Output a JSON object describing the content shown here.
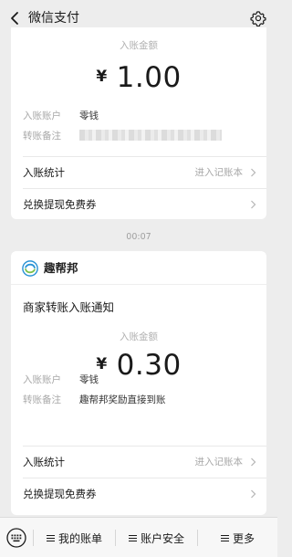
{
  "header": {
    "title": "微信支付"
  },
  "time_divider": "00:07",
  "messages": [
    {
      "amount_label": "入账金额",
      "currency_symbol": "¥",
      "amount": "1.00",
      "account_key": "入账账户",
      "account_value": "零钱",
      "remark_key": "转账备注",
      "rows": [
        {
          "label": "入账统计",
          "hint": "进入记账本"
        },
        {
          "label": "兑换提现免费券",
          "hint": ""
        }
      ]
    },
    {
      "brand_name": "趣帮邦",
      "notice_title": "商家转账入账通知",
      "amount_label": "入账金额",
      "currency_symbol": "¥",
      "amount": "0.30",
      "account_key": "入账账户",
      "account_value": "零钱",
      "remark_key": "转账备注",
      "remark_value": "趣帮邦奖励直接到账",
      "rows": [
        {
          "label": "入账统计",
          "hint": "进入记账本"
        },
        {
          "label": "兑换提现免费券",
          "hint": ""
        }
      ]
    }
  ],
  "bottom_menu": {
    "tabs": [
      "我的账单",
      "账户安全",
      "更多"
    ]
  },
  "icons": {
    "back": "back-icon",
    "settings": "gear-icon",
    "keyboard": "keyboard-icon",
    "chevron": "chevron-right-icon"
  }
}
